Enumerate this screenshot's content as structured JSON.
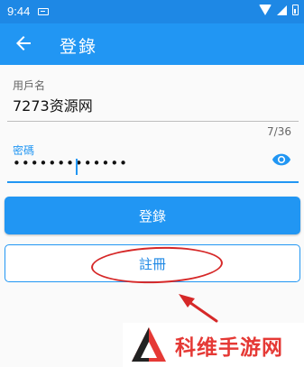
{
  "status_bar": {
    "time": "9:44",
    "icons": [
      "notification-icon",
      "wifi-icon",
      "signal-icon",
      "battery-icon"
    ]
  },
  "app_bar": {
    "back_icon": "arrow-left-icon",
    "title": "登錄",
    "color": "#2196f3"
  },
  "form": {
    "username": {
      "label": "用戶名",
      "value": "7273资源网"
    },
    "password": {
      "label": "密碼",
      "value": "•••••••••••••",
      "char_count": "7/36",
      "toggle_icon": "eye-icon"
    },
    "login_button": "登錄",
    "register_button": "註冊"
  },
  "annotation": {
    "color": "#d62828",
    "shapes": [
      "ellipse",
      "arrow"
    ]
  },
  "watermark": {
    "text": "科维手游网",
    "logo_icon": "triangle-logo-icon",
    "color": "#e53935"
  }
}
